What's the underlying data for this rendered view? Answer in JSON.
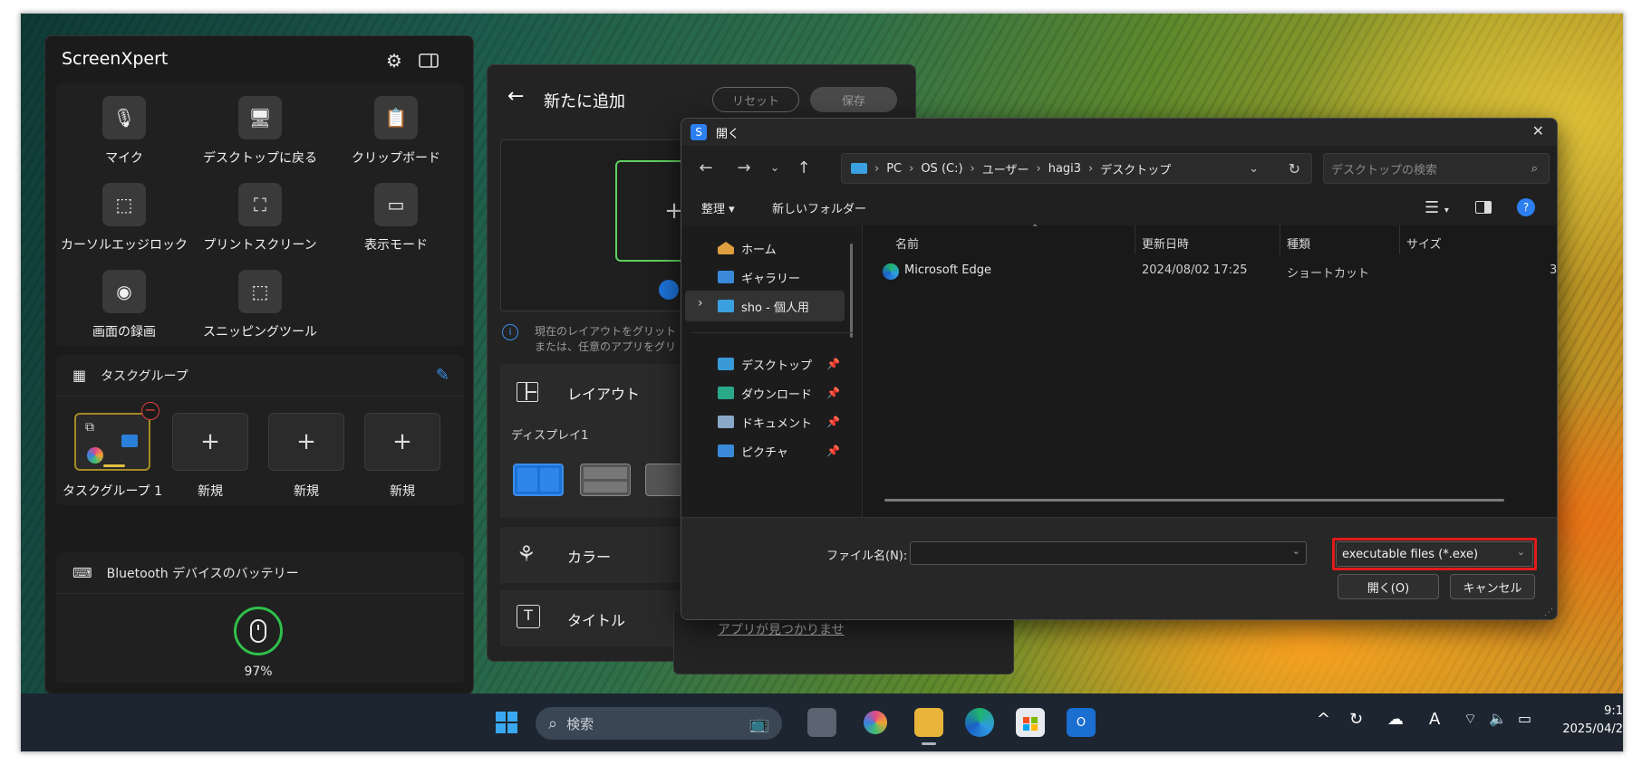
{
  "screenxpert": {
    "title": "ScreenXpert",
    "tools": [
      {
        "label": "マイク",
        "icon": "microphone-icon",
        "glyph": "🎙"
      },
      {
        "label": "デスクトップに戻る",
        "icon": "desktop-icon",
        "glyph": "🖥"
      },
      {
        "label": "クリップボード",
        "icon": "clipboard-icon",
        "glyph": "📋"
      },
      {
        "label": "カーソルエッジロック",
        "icon": "cursor-lock-icon",
        "glyph": "⬚"
      },
      {
        "label": "プリントスクリーン",
        "icon": "print-screen-icon",
        "glyph": "⛶"
      },
      {
        "label": "表示モード",
        "icon": "display-mode-icon",
        "glyph": "▭"
      },
      {
        "label": "画面の録画",
        "icon": "screen-record-icon",
        "glyph": "◉"
      },
      {
        "label": "スニッピングツール",
        "icon": "snipping-tool-icon",
        "glyph": "⬚"
      }
    ],
    "task_group": {
      "header": "タスクグループ",
      "items": [
        {
          "label": "タスクグループ 1"
        },
        {
          "label": "新規"
        },
        {
          "label": "新規"
        },
        {
          "label": "新規"
        }
      ]
    },
    "bluetooth": {
      "header": "Bluetooth デバイスのバッテリー",
      "percent": "97%",
      "level": 0.97
    }
  },
  "add_panel": {
    "title": "新たに追加",
    "reset_label": "リセット",
    "save_label": "保存",
    "info_line1": "現在のレイアウトをグリット",
    "info_line2": "または、任意のアプリをグリ",
    "layout_label": "レイアウト",
    "display_label": "ディスプレイ1",
    "color_label": "カラー",
    "title_label": "タイトル",
    "app_not_found": "アプリが見つかりませ"
  },
  "dialog": {
    "title": "開く",
    "breadcrumb": [
      "PC",
      "OS (C:)",
      "ユーザー",
      "hagi3",
      "デスクトップ"
    ],
    "search_placeholder": "デスクトップの検索",
    "organize_label": "整理",
    "new_folder_label": "新しいフォルダー",
    "nav_items": [
      {
        "label": "ホーム",
        "color": "#e0a040"
      },
      {
        "label": "ギャラリー",
        "color": "#3a8ad8"
      },
      {
        "label": "sho - 個人用",
        "color": "#3aa0e0"
      },
      {
        "label": "デスクトップ",
        "color": "#3a9ad8"
      },
      {
        "label": "ダウンロード",
        "color": "#2aa88a"
      },
      {
        "label": "ドキュメント",
        "color": "#8aa8c8"
      },
      {
        "label": "ピクチャ",
        "color": "#3a8ad8"
      }
    ],
    "columns": [
      "名前",
      "更新日時",
      "種類",
      "サイズ"
    ],
    "files": [
      {
        "name": "Microsoft Edge",
        "modified": "2024/08/02 17:25",
        "type": "ショートカット",
        "size": "3"
      }
    ],
    "filename_label": "ファイル名(N):",
    "filename_value": "",
    "filetype_value": "executable files (*.exe)",
    "open_label": "開く(O)",
    "cancel_label": "キャンセル"
  },
  "taskbar": {
    "search_placeholder": "検索",
    "time": "9:1",
    "date": "2025/04/2"
  },
  "colors": {
    "highlight_red": "#e21b1b",
    "battery_green": "#2fbf4a",
    "accent_blue": "#1d72d8"
  }
}
